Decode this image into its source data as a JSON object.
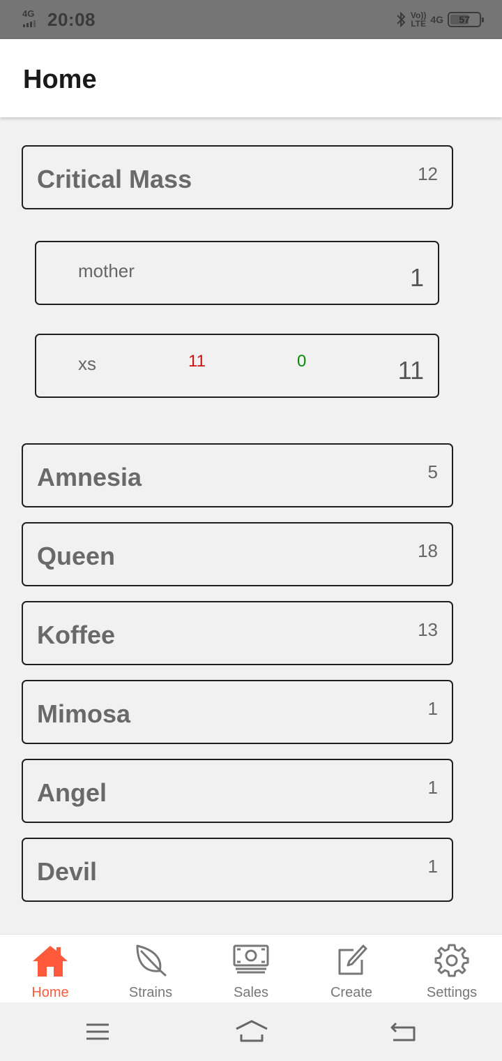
{
  "status_bar": {
    "network": "4G",
    "time": "20:08",
    "volte_top": "Vo))",
    "volte_bottom": "LTE",
    "network_right": "4G",
    "battery": "57"
  },
  "app_bar": {
    "title": "Home"
  },
  "strains": [
    {
      "name": "Critical Mass",
      "count": "12",
      "expanded": true,
      "children": [
        {
          "name": "mother",
          "total": "1"
        },
        {
          "name": "xs",
          "red_value": "11",
          "green_value": "0",
          "total": "11"
        }
      ]
    },
    {
      "name": "Amnesia",
      "count": "5"
    },
    {
      "name": "Queen",
      "count": "18"
    },
    {
      "name": "Koffee",
      "count": "13"
    },
    {
      "name": "Mimosa",
      "count": "1"
    },
    {
      "name": "Angel",
      "count": "1"
    },
    {
      "name": "Devil",
      "count": "1"
    }
  ],
  "bottom_nav": {
    "active": "home",
    "items": [
      {
        "label": "Home",
        "icon": "home-icon"
      },
      {
        "label": "Strains",
        "icon": "leaf-icon"
      },
      {
        "label": "Sales",
        "icon": "money-icon"
      },
      {
        "label": "Create",
        "icon": "edit-icon"
      },
      {
        "label": "Settings",
        "icon": "gear-icon"
      }
    ]
  },
  "colors": {
    "accent": "#ff5a3c",
    "negative": "#cc1111",
    "positive": "#0a8a0a",
    "background": "#f1f1f1"
  }
}
